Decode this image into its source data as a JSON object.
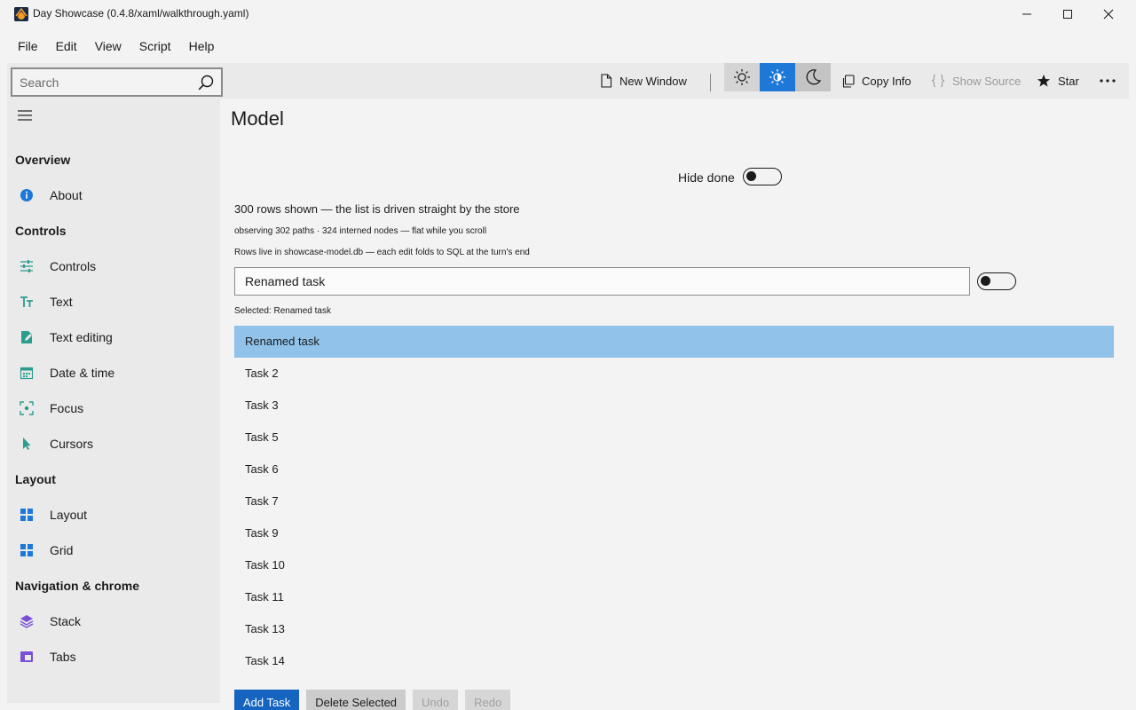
{
  "window": {
    "title": "Day Showcase (0.4.8/xaml/walkthrough.yaml)"
  },
  "menu": [
    "File",
    "Edit",
    "View",
    "Script",
    "Help"
  ],
  "toolbar": {
    "search_placeholder": "Search",
    "new_window": "New Window",
    "copy_info": "Copy Info",
    "show_source": "Show Source",
    "star": "Star"
  },
  "sidebar": {
    "sections": [
      {
        "header": "Overview",
        "items": [
          {
            "label": "About",
            "icon": "info-icon"
          }
        ]
      },
      {
        "header": "Controls",
        "items": [
          {
            "label": "Controls",
            "icon": "sliders-icon"
          },
          {
            "label": "Text",
            "icon": "text-icon"
          },
          {
            "label": "Text editing",
            "icon": "pen-icon"
          },
          {
            "label": "Date & time",
            "icon": "calendar-icon"
          },
          {
            "label": "Focus",
            "icon": "focus-icon"
          },
          {
            "label": "Cursors",
            "icon": "cursor-icon"
          }
        ]
      },
      {
        "header": "Layout",
        "items": [
          {
            "label": "Layout",
            "icon": "layout-icon"
          },
          {
            "label": "Grid",
            "icon": "grid-icon"
          }
        ]
      },
      {
        "header": "Navigation & chrome",
        "items": [
          {
            "label": "Stack",
            "icon": "stack-icon"
          },
          {
            "label": "Tabs",
            "icon": "tabs-icon"
          }
        ]
      }
    ]
  },
  "main": {
    "title": "Model",
    "hide_done_label": "Hide done",
    "rows_shown": "300 rows shown — the list is driven straight by the store",
    "observing": "observing 302 paths · 324 interned nodes — flat while you scroll",
    "rows_live": "Rows live in showcase-model.db — each edit folds to SQL at the turn's end",
    "name_value": "Renamed task",
    "selected": "Selected: Renamed task",
    "tasks": [
      "Renamed task",
      "Task 2",
      "Task 3",
      "Task 5",
      "Task 6",
      "Task 7",
      "Task 9",
      "Task 10",
      "Task 11",
      "Task 13",
      "Task 14"
    ],
    "buttons": {
      "add": "Add Task",
      "delete": "Delete Selected",
      "undo": "Undo",
      "redo": "Redo"
    }
  },
  "colors": {
    "accent": "#1e78d7",
    "selected_row": "#90c2ea",
    "sidebar_bg": "#eaeaea"
  }
}
